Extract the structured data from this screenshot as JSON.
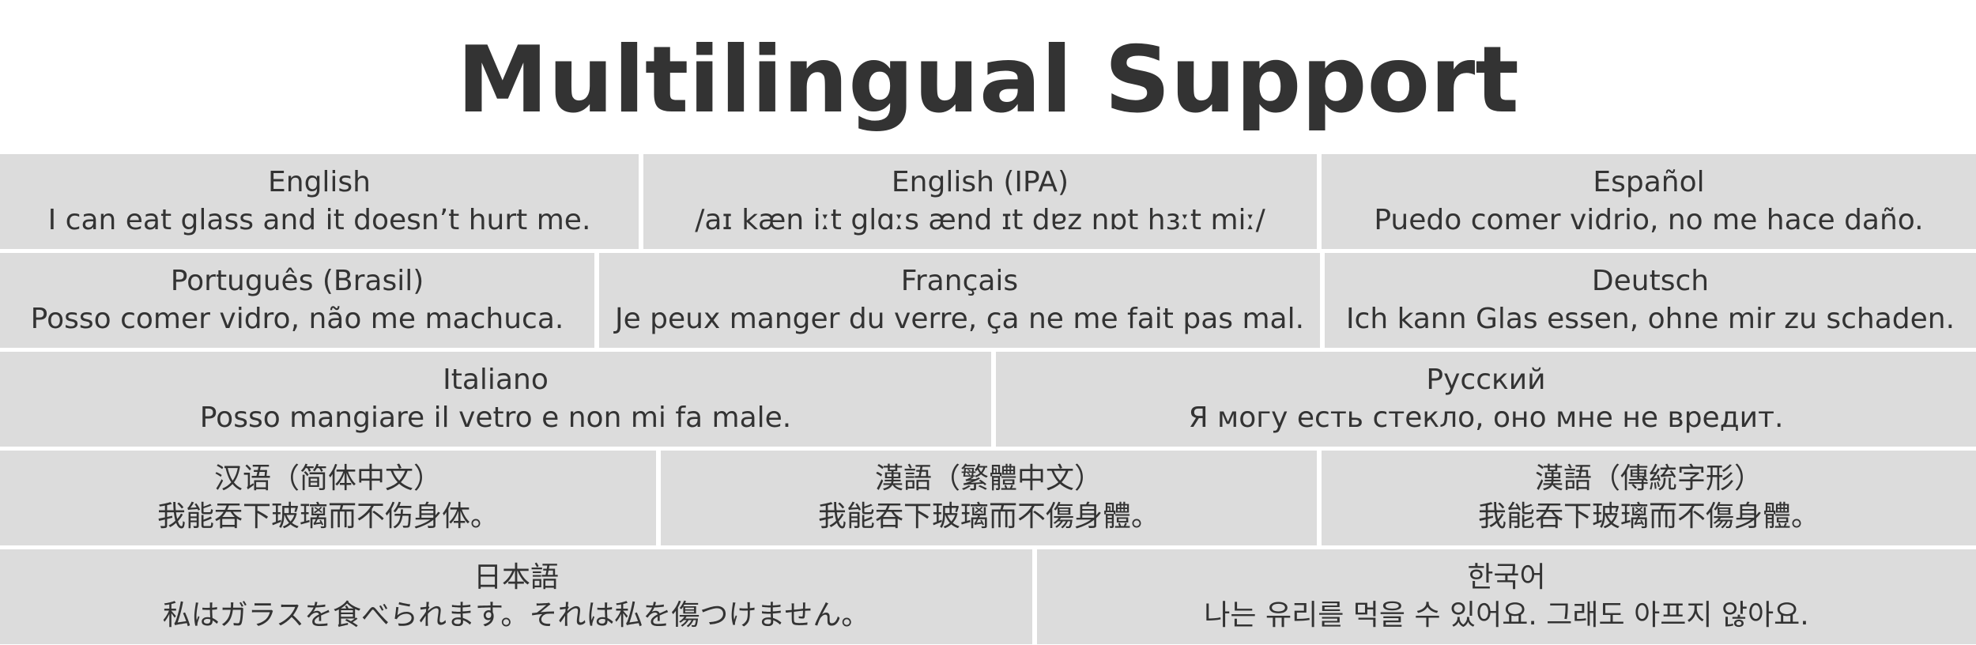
{
  "title": "Multilingual Support",
  "rows": [
    {
      "cells": [
        {
          "language": "English",
          "sentence": "I can eat glass and it doesn’t hurt me."
        },
        {
          "language": "English (IPA)",
          "sentence": "/aɪ kæn iːt glɑːs ænd ɪt dɐz nɒt hɜːt miː/"
        },
        {
          "language": "Español",
          "sentence": "Puedo comer vidrio, no me hace daño."
        }
      ]
    },
    {
      "cells": [
        {
          "language": "Português (Brasil)",
          "sentence": "Posso comer vidro, não me machuca."
        },
        {
          "language": "Français",
          "sentence": "Je peux manger du verre, ça ne me fait pas mal."
        },
        {
          "language": "Deutsch",
          "sentence": "Ich kann Glas essen, ohne mir zu schaden."
        }
      ]
    },
    {
      "cells": [
        {
          "language": "Italiano",
          "sentence": "Posso mangiare il vetro e non mi fa male."
        },
        {
          "language": "Русский",
          "sentence": "Я могу есть стекло, оно мне не вредит."
        }
      ]
    },
    {
      "cells": [
        {
          "language": "汉语（简体中文）",
          "sentence": "我能吞下玻璃而不伤身体。"
        },
        {
          "language": "漢語（繁體中文）",
          "sentence": "我能吞下玻璃而不傷身體。"
        },
        {
          "language": "漢語（傳統字形）",
          "sentence": "我能吞下玻璃而不傷身體。"
        }
      ]
    },
    {
      "cells": [
        {
          "language": "日本語",
          "sentence": "私はガラスを食べられます。それは私を傷つけません。"
        },
        {
          "language": "한국어",
          "sentence": "나는 유리를 먹을 수 있어요. 그래도 아프지 않아요."
        }
      ]
    }
  ]
}
